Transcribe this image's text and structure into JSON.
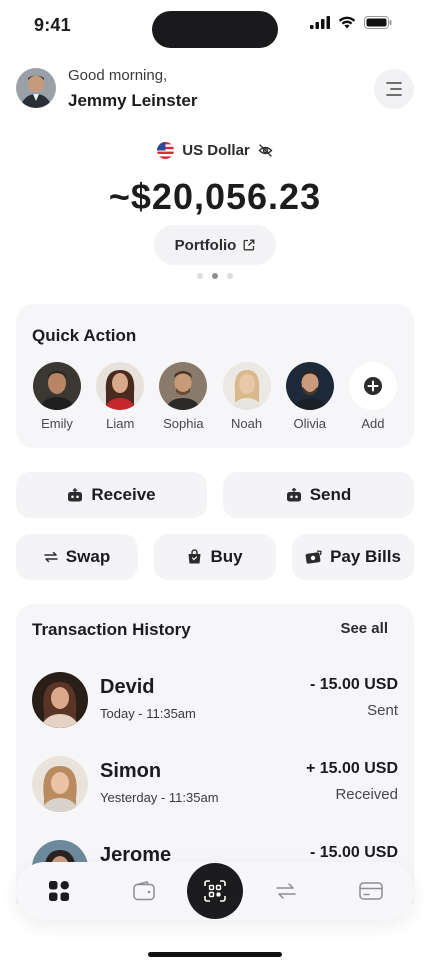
{
  "status_bar": {
    "time": "9:41"
  },
  "header": {
    "greeting": "Good morning,",
    "user_name": "Jemmy Leinster"
  },
  "balance": {
    "currency": "US Dollar",
    "amount": "~$20,056.23",
    "portfolio_label": "Portfolio",
    "page_count": 3,
    "active_page": 2
  },
  "quick_action": {
    "title": "Quick Action",
    "contacts": [
      {
        "name": "Emily"
      },
      {
        "name": "Liam"
      },
      {
        "name": "Sophia"
      },
      {
        "name": "Noah"
      },
      {
        "name": "Olivia"
      }
    ],
    "add_label": "Add"
  },
  "actions": {
    "receive": "Receive",
    "send": "Send",
    "swap": "Swap",
    "buy": "Buy",
    "pay_bills": "Pay Bills"
  },
  "transactions": {
    "title": "Transaction History",
    "see_all": "See all",
    "items": [
      {
        "name": "Devid",
        "date": "Today - 11:35am",
        "amount": "- 15.00 USD",
        "status": "Sent"
      },
      {
        "name": "Simon",
        "date": "Yesterday - 11:35am",
        "amount": "+ 15.00 USD",
        "status": "Received"
      },
      {
        "name": "Jerome",
        "date": "",
        "amount": "- 15.00 USD",
        "status": ""
      }
    ]
  },
  "nav": {
    "items": [
      "grid-icon",
      "wallet-icon",
      "scan-icon",
      "transfer-icon",
      "card-icon"
    ]
  },
  "colors": {
    "accent": "#1c1c1e",
    "card_bg": "#f6f6f8"
  }
}
